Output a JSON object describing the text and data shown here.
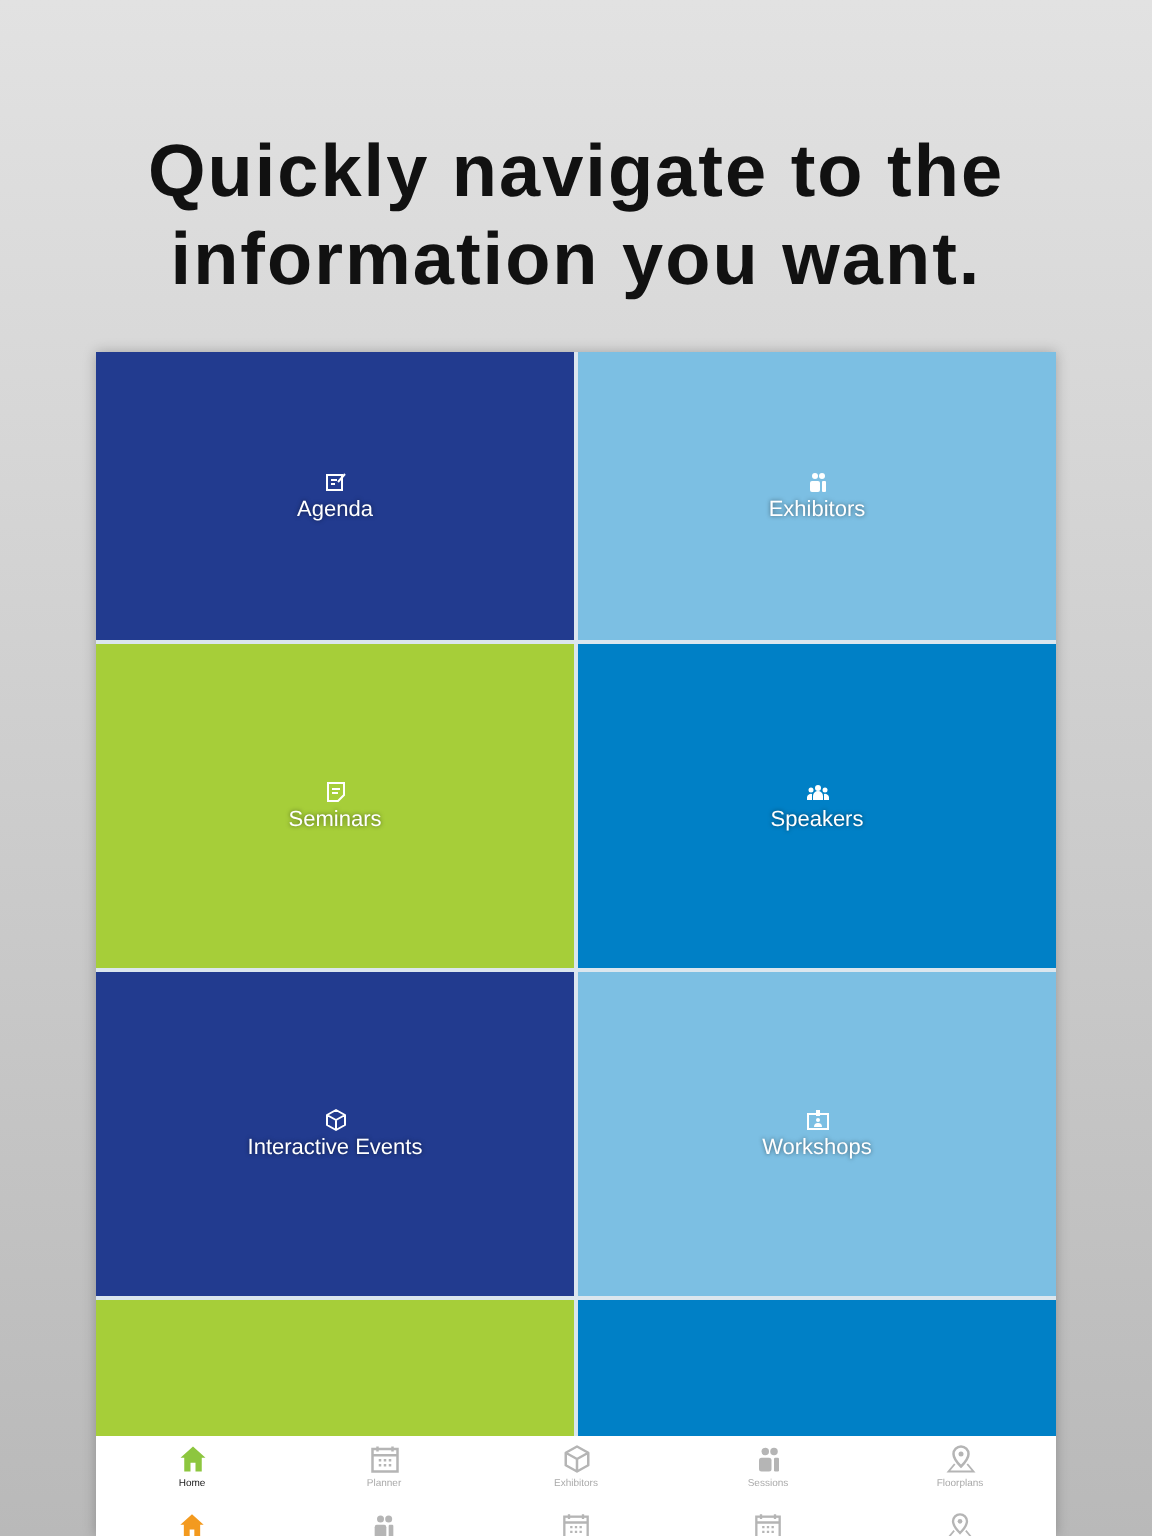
{
  "headline": "Quickly navigate to the information you want.",
  "tiles": [
    {
      "label": "Agenda",
      "color": "#223b8f"
    },
    {
      "label": "Exhibitors",
      "color": "#7cbfe3"
    },
    {
      "label": "Seminars",
      "color": "#a6ce39"
    },
    {
      "label": "Speakers",
      "color": "#0080c6"
    },
    {
      "label": "Interactive Events",
      "color": "#223b8f"
    },
    {
      "label": "Workshops",
      "color": "#7cbfe3"
    },
    {
      "color": "#a6ce39"
    },
    {
      "color": "#0080c6"
    }
  ],
  "tab_bar": [
    {
      "label": "Home",
      "selected": true
    },
    {
      "label": "Planner",
      "selected": false
    },
    {
      "label": "Exhibitors",
      "selected": false
    },
    {
      "label": "Sessions",
      "selected": false
    },
    {
      "label": "Floorplans",
      "selected": false
    }
  ]
}
